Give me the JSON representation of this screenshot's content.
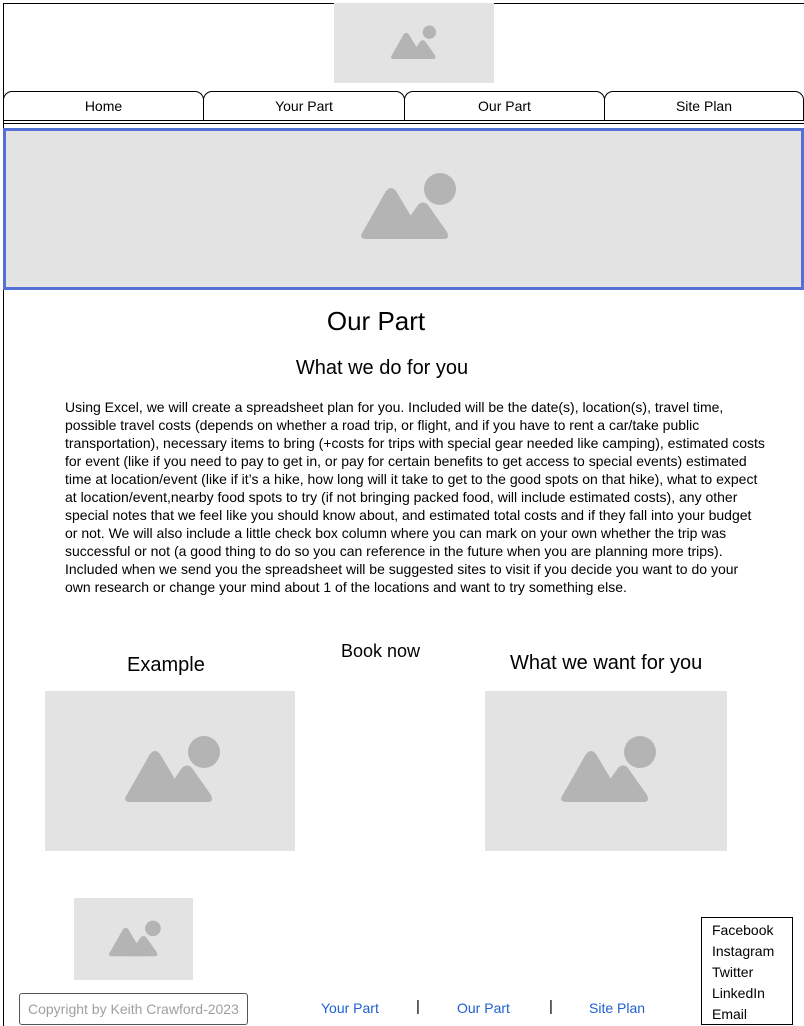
{
  "nav": {
    "tabs": [
      {
        "label": "Home"
      },
      {
        "label": "Your Part"
      },
      {
        "label": "Our Part"
      },
      {
        "label": "Site Plan"
      }
    ]
  },
  "page": {
    "title": "Our Part",
    "subtitle": "What we do for you",
    "description": "Using Excel, we will create a spreadsheet plan for you. Included will be the date(s), location(s), travel time, possible travel costs (depends on whether a road trip, or flight, and if you have to rent a car/take public transportation), necessary items to bring (+costs for trips with special gear needed like camping), estimated costs for event (like if you need to pay to get in, or pay for certain benefits to get access to special events) estimated time at location/event (like if it’s a hike, how long will it take to get to the good spots on that hike), what to expect at location/event,nearby food spots to try (if not bringing packed food, will include estimated costs), any other special notes that we feel like you should know about, and estimated total costs and if they fall into your budget or not. We will also include a little check box column where you can mark on your own whether the trip was successful or not (a good thing to do so you can reference in the future when you are planning more trips). Included when we send you the spreadsheet will be suggested sites to visit if you decide you want to do your own research or change your mind about 1 of the locations and want to try something else."
  },
  "sections": {
    "example": "Example",
    "book_now": "Book now",
    "want": "What we want for you"
  },
  "footer": {
    "copyright": "Copyright by Keith Crawford-2023",
    "links": [
      "Your Part",
      "Our Part",
      "Site Plan"
    ],
    "separator": "|",
    "social": [
      "Facebook",
      "Instagram",
      "Twitter",
      "LinkedIn",
      "Email"
    ]
  },
  "colors": {
    "placeholder_bg": "#e3e3e3",
    "placeholder_icon": "#b4b4b4",
    "hero_border": "#5470d6",
    "link": "#1f5fd1"
  },
  "icons": {
    "placeholder": "image-placeholder-icon"
  }
}
